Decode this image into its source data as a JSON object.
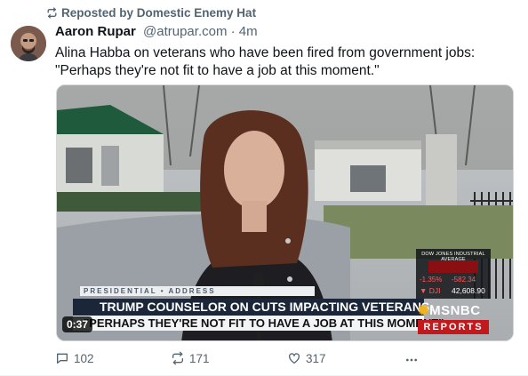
{
  "repost": {
    "text": "Reposted by Domestic Enemy Hat",
    "icon": "repost-icon"
  },
  "author": {
    "name": "Aaron Rupar",
    "handle": "@atrupar.com",
    "separator": " · ",
    "time": "4m"
  },
  "post": {
    "text": "Alina Habba on veterans who have been fired from government jobs: \"Perhaps they're not fit to have a job at this moment.\""
  },
  "media": {
    "duration": "0:37",
    "chyron": {
      "kicker": "PRESIDENTIAL • ADDRESS",
      "headline1": "TRUMP COUNSELOR ON CUTS IMPACTING VETERANS:",
      "headline2": "\"PERHAPS THEY'RE NOT FIT TO HAVE A JOB AT THIS MOMENT\""
    },
    "ticker": {
      "title": "DOW JONES INDUSTRIAL AVERAGE",
      "pct": "-1.35%",
      "change": "-582.34",
      "symbol": "▼ DJI",
      "value": "42,608.90"
    },
    "network": {
      "logo": "MSNBC",
      "show": "REPORTS"
    }
  },
  "actions": {
    "replies": "102",
    "reposts": "171",
    "likes": "317"
  },
  "colors": {
    "text": "#0f1419",
    "muted": "#536471",
    "chyron_navy": "#1b2738",
    "msnbc_red": "#c3181c"
  }
}
